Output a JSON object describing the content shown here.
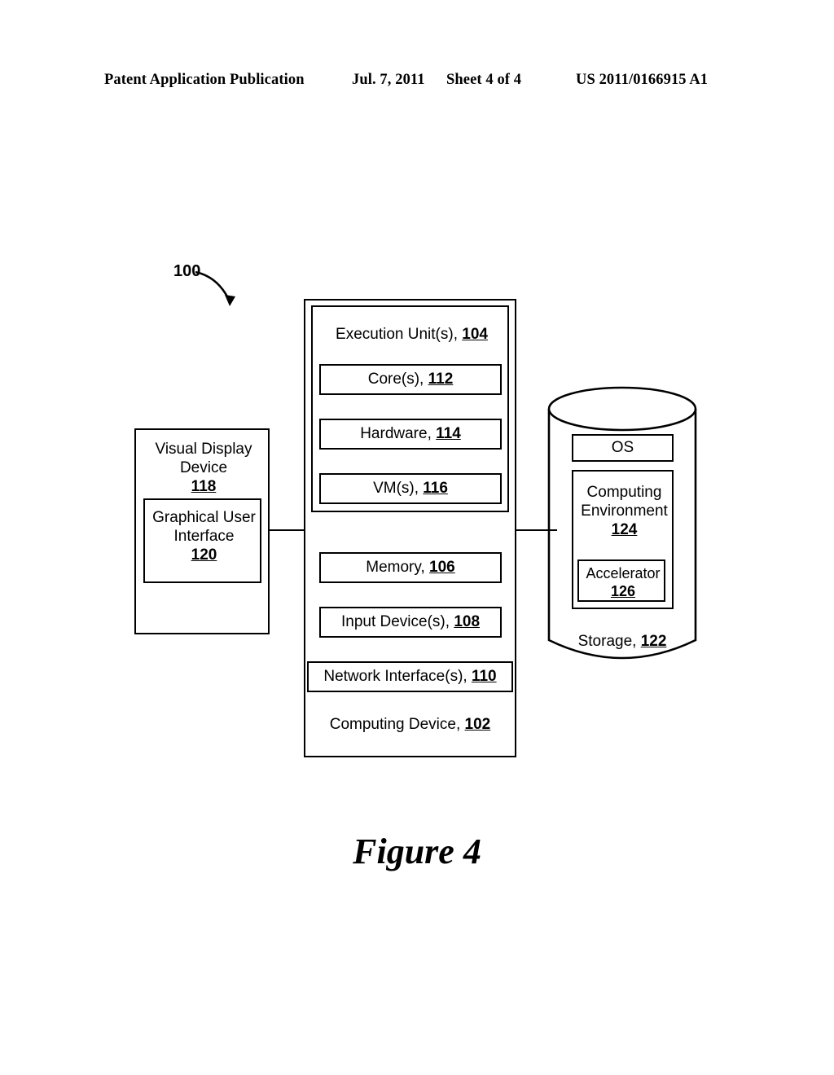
{
  "header": {
    "publication": "Patent Application Publication",
    "date": "Jul. 7, 2011",
    "sheet": "Sheet 4 of 4",
    "patent_number": "US 2011/0166915 A1"
  },
  "figure": {
    "caption": "Figure 4",
    "system_ref": "100"
  },
  "diagram": {
    "visual_display_device": {
      "label": "Visual Display Device",
      "ref": "118",
      "gui": {
        "label": "Graphical User Interface",
        "ref": "120"
      }
    },
    "computing_device": {
      "label": "Computing Device,",
      "ref": "102",
      "execution_unit": {
        "label": "Execution Unit(s),",
        "ref": "104",
        "children": [
          {
            "label": "Core(s),",
            "ref": "112"
          },
          {
            "label": "Hardware,",
            "ref": "114"
          },
          {
            "label": "VM(s),",
            "ref": "116"
          }
        ]
      },
      "components": [
        {
          "label": "Memory,",
          "ref": "106"
        },
        {
          "label": "Input Device(s),",
          "ref": "108"
        },
        {
          "label": "Network Interface(s),",
          "ref": "110"
        }
      ]
    },
    "storage": {
      "label": "Storage,",
      "ref": "122",
      "os": {
        "label": "OS"
      },
      "computing_environment": {
        "label": "Computing Environment",
        "ref": "124",
        "accelerator": {
          "label": "Accelerator",
          "ref": "126"
        }
      }
    }
  },
  "colors": {
    "ink": "#000000",
    "paper": "#ffffff"
  }
}
